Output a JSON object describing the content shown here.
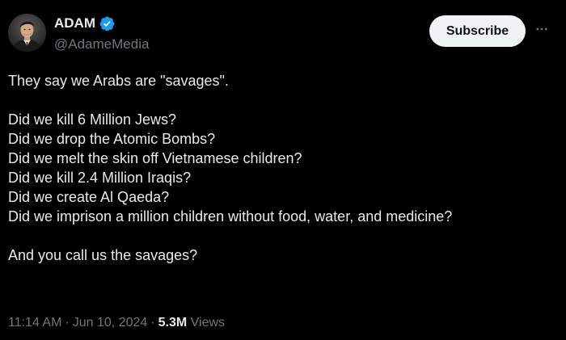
{
  "author": {
    "display_name": "ADAM",
    "handle": "@AdameMedia",
    "verified_icon": "verified-badge-icon",
    "avatar_icon": "profile-avatar"
  },
  "actions": {
    "subscribe_label": "Subscribe",
    "more_icon": "more-horizontal-icon"
  },
  "tweet": {
    "opening": "They say we Arabs are \"savages\".",
    "questions": [
      "Did we kill 6 Million Jews?",
      "Did we drop the Atomic Bombs?",
      "Did we melt the skin off Vietnamese children?",
      "Did we kill 2.4 Million Iraqis?",
      "Did we create Al Qaeda?",
      "Did we imprison a million children without food, water, and medicine?"
    ],
    "closing": "And you call us the savages?"
  },
  "meta": {
    "time": "11:14 AM",
    "separator": "·",
    "date": "Jun 10, 2024",
    "views_count": "5.3M",
    "views_label": "Views"
  },
  "colors": {
    "background": "#000000",
    "text_primary": "#e7e9ea",
    "text_secondary": "#71767b",
    "verified": "#1d9bf0",
    "button_bg": "#eff3f4",
    "button_text": "#0f1419"
  }
}
